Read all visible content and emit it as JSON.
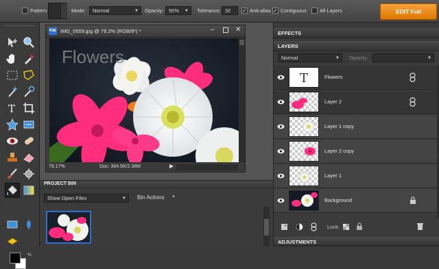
{
  "options_bar": {
    "pattern_label": "Pattern",
    "mode_label": "Mode:",
    "mode_value": "Normal",
    "opacity_label": "Opacity:",
    "opacity_value": "50%",
    "tolerance_label": "Tolerance:",
    "tolerance_value": "32",
    "antialias_label": "Anti-alias",
    "contiguous_label": "Contiguous",
    "all_layers_label": "All Layers",
    "edit_full_label": "EDIT Full"
  },
  "document": {
    "badge": "PSE",
    "title": "IMG_0559.jpg @ 79.2% (RGB/8*) *",
    "canvas_text": "Flowers",
    "zoom": "79.17%",
    "doc_info": "Doc: 364.5K/2.38M"
  },
  "project_bin": {
    "title": "PROJECT BIN",
    "show_value": "Show Open Files",
    "bin_actions_label": "Bin Actions"
  },
  "panels": {
    "effects_title": "EFFECTS",
    "layers_title": "LAYERS",
    "blend_mode": "Normal",
    "opacity_label": "Opacity:",
    "lock_label": "Lock:",
    "adjustments_title": "ADJUSTMENTS",
    "layers": [
      {
        "name": "Flowers",
        "kind": "text",
        "linked": true
      },
      {
        "name": "Layer 2",
        "kind": "pink",
        "linked": true
      },
      {
        "name": "Layer 1 copy",
        "kind": "white"
      },
      {
        "name": "Layer 2 copy",
        "kind": "pink"
      },
      {
        "name": "Layer 1",
        "kind": "white"
      },
      {
        "name": "Background",
        "kind": "photo",
        "locked": true
      }
    ]
  },
  "colors": {
    "accent_orange": "#f08a1a",
    "panel_bg": "#3b3b3b",
    "flower_pink": "#ff2d7e",
    "flower_white": "#f4f4f0"
  }
}
